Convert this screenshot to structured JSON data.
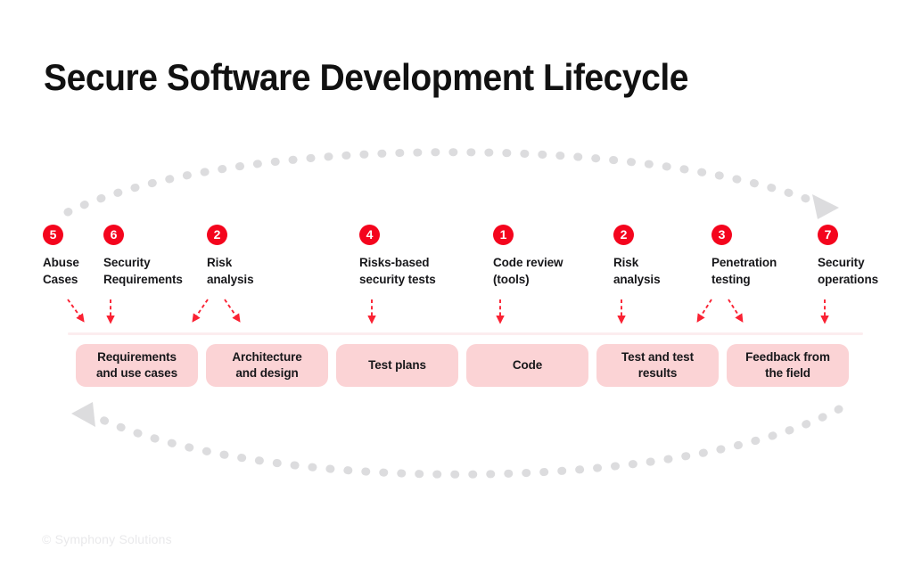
{
  "title": "Secure Software Development Lifecycle",
  "footer": "© Symphony Solutions",
  "colors": {
    "badge_red": "#f4051d",
    "arrow_red": "#fa2233",
    "box_pink": "#fbd3d5",
    "divider_pink": "#fcedef",
    "arc_gray": "#dcdcde",
    "text_dark": "#17171a",
    "footer_gray": "#e9e9eb"
  },
  "phases": [
    {
      "number": "5",
      "label": "Abuse\nCases"
    },
    {
      "number": "6",
      "label": "Security\nRequirements"
    },
    {
      "number": "2",
      "label": "Risk\nanalysis"
    },
    {
      "number": "4",
      "label": "Risks-based\nsecurity tests"
    },
    {
      "number": "1",
      "label": "Code review\n(tools)"
    },
    {
      "number": "2",
      "label": "Risk\nanalysis"
    },
    {
      "number": "3",
      "label": "Penetration\ntesting"
    },
    {
      "number": "7",
      "label": "Security\noperations"
    }
  ],
  "artifacts": [
    {
      "label": "Requirements\nand use cases"
    },
    {
      "label": "Architecture\nand design"
    },
    {
      "label": "Test plans"
    },
    {
      "label": "Code"
    },
    {
      "label": "Test and test\nresults"
    },
    {
      "label": "Feedback from\nthe field"
    }
  ],
  "loop_arrows": {
    "top_direction": "right",
    "bottom_direction": "left"
  }
}
